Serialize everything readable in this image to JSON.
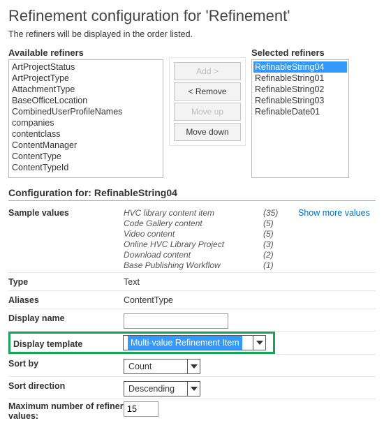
{
  "title_prefix": "Refinement configuration for '",
  "title_name": "Refinement",
  "title_suffix": "'",
  "subhead": "The refiners will be displayed in the order listed.",
  "available_label": "Available refiners",
  "selected_label": "Selected refiners",
  "available": [
    "ArtProjectStatus",
    "ArtProjectType",
    "AttachmentType",
    "BaseOfficeLocation",
    "CombinedUserProfileNames",
    "companies",
    "contentclass",
    "ContentManager",
    "ContentType",
    "ContentTypeId"
  ],
  "selected": [
    "RefinableString04",
    "RefinableString01",
    "RefinableString02",
    "RefinableString03",
    "RefinableDate01"
  ],
  "buttons": {
    "add": "Add >",
    "remove": "< Remove",
    "moveup": "Move up",
    "movedown": "Move down"
  },
  "config_for_label": "Configuration for: ",
  "config_for_value": "RefinableString04",
  "rows": {
    "sample_values": "Sample values",
    "type": "Type",
    "type_val": "Text",
    "aliases": "Aliases",
    "aliases_val": "ContentType",
    "display_name": "Display name",
    "display_name_val": "",
    "display_template": "Display template",
    "display_template_val": "Multi-value Refinement Item",
    "sort_by": "Sort by",
    "sort_by_val": "Count",
    "sort_direction": "Sort direction",
    "sort_direction_val": "Descending",
    "max_num": "Maximum number of refiner values:",
    "max_num_val": "15"
  },
  "show_more": "Show more values",
  "samples": [
    {
      "name": "HVC library content item",
      "count": "(35)"
    },
    {
      "name": "Code Gallery content",
      "count": "(5)"
    },
    {
      "name": "Video content",
      "count": "(5)"
    },
    {
      "name": "Online HVC Library Project",
      "count": "(3)"
    },
    {
      "name": "Download content",
      "count": "(2)"
    },
    {
      "name": "Base Publishing Workflow",
      "count": "(1)"
    }
  ]
}
